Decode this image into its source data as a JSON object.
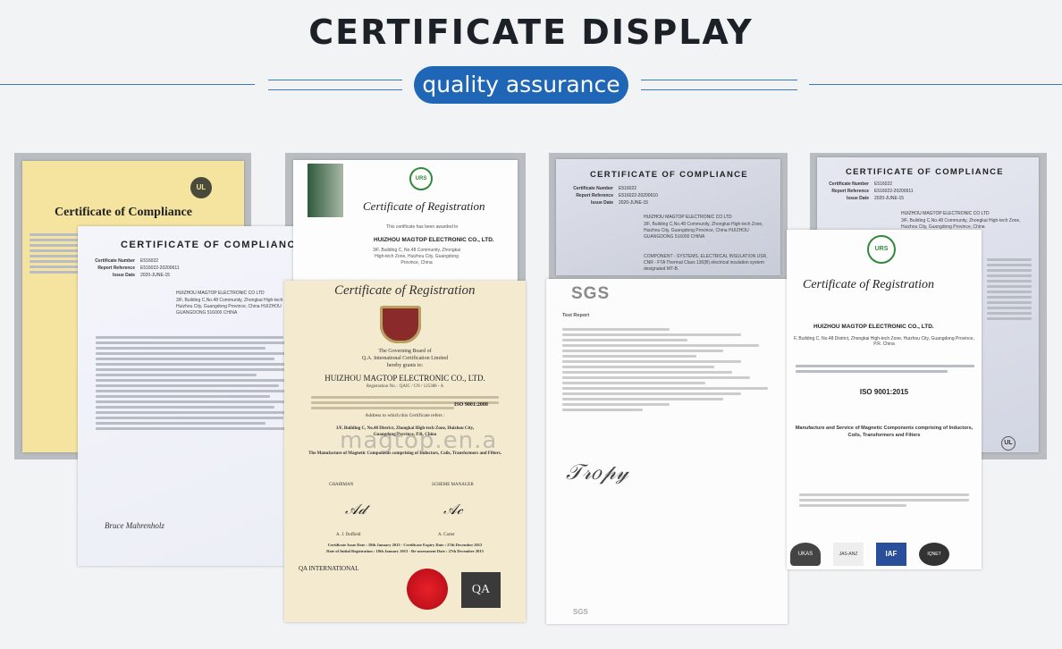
{
  "header": {
    "title": "CERTIFICATE DISPLAY",
    "subtitle": "quality assurance"
  },
  "watermark": "magtop.en.a",
  "certs": {
    "yellow": {
      "title": "Certificate of Compliance",
      "brand": "ul-mark",
      "color": "#f5e7a6"
    },
    "ul1": {
      "heading": "CERTIFICATE OF COMPLIANCE",
      "fields": [
        {
          "k": "Certificate Number",
          "v": "E516022"
        },
        {
          "k": "Report Reference",
          "v": "E516022-20200611"
        },
        {
          "k": "Issue Date",
          "v": "2020-JUNE-15"
        }
      ],
      "issued_to": "HUIZHOU MAGTOP ELECTRONIC CO LTD",
      "address": "3/F, Building C,No.48 Community, Zhongkai High-tech Zone, Huizhou City, Guangdong Province, China HUIZHOU GUANGDONG 516000 CHINA",
      "signature": "Bruce Mahrenholz"
    },
    "ul2": {
      "heading": "CERTIFICATE OF COMPLIANCE",
      "fields": [
        {
          "k": "Certificate Number",
          "v": "E516022"
        },
        {
          "k": "Report Reference",
          "v": "E516022-20200610"
        },
        {
          "k": "Issue Date",
          "v": "2020-JUNE-15"
        }
      ],
      "issued_to": "HUIZHOU MAGTOP ELECTRONIC CO LTD",
      "address": "3/F, Building C,No.48 Community, Zhongkai High-tech Zone, Huizhou City, Guangdong Province, China HUIZHOU GUANGDONG 516000 CHINA",
      "representative": "COMPONENT - SYSTEMS, ELECTRICAL INSULATION USR, CNR - FTA Thermal Class 130(B) electrical insulation system designated MT-B."
    },
    "ul3": {
      "heading": "CERTIFICATE OF COMPLIANCE",
      "fields": [
        {
          "k": "Certificate Number",
          "v": "E516022"
        },
        {
          "k": "Report Reference",
          "v": "E516022-20200611"
        },
        {
          "k": "Issue Date",
          "v": "2020-JUNE-15"
        }
      ],
      "issued_to": "HUIZHOU MAGTOP ELECTRONIC CO LTD",
      "address": "3/F, Building C,No.48 Community, Zhongkai High-tech Zone, Huizhou City, Guangdong Province, China"
    },
    "reg1": {
      "title": "Certificate of Registration",
      "awarded": "This certificate has been awarded to",
      "company": "HUIZHOU MAGTOP ELECTRONIC CO., LTD.",
      "address": "3/F, Building C, No.48 Community, Zhongkai High-tech Zone, Huizhou City, Guangdong Province, China"
    },
    "qa": {
      "title": "Certificate of Registration",
      "board": "The Governing Board of",
      "org": "Q.A. International Certification Limited",
      "grants": "hereby grants to:",
      "company": "HUIZHOU MAGTOP ELECTRONIC CO., LTD.",
      "reg_no": "Registration No. : QAIC / CN / 125388 - A",
      "standard": "ISO 9001:2008",
      "address_label": "Address to which this Certificate refers :",
      "address": "3/F, Building C, No.48 District, Zhongkai High-tech Zone, Huizhou City, Guangdong Province, P.R. China",
      "scope": "The Manufacture of Magnetic Components comprising of Inductors, Coils, Transformers and Filters.",
      "chairman": "CHAIRMAN",
      "scheme": "SCHEME MANAGER",
      "sig1": "A. J. Duffield",
      "sig2": "A. Carter",
      "issue": "Certificate Issue Date : 18th January 2013 - Certificate Expiry Date : 27th December 2013",
      "initial": "Date of Initial Registration : 18th January 2013 - Re-assessment Date : 27th December 2013",
      "footer_org": "QA INTERNATIONAL"
    },
    "sgs": {
      "logo": "SGS",
      "heading": "Test Report",
      "footer_logo": "SGS"
    },
    "reg2": {
      "title": "Certificate of Registration",
      "company": "HUIZHOU MAGTOP ELECTRONIC CO., LTD.",
      "address": "F, Building C, No.48 District, Zhongkai High-tech Zone, Huizhou City, Guangdong Province, P.R. China",
      "standard": "ISO 9001:2015",
      "scope": "Manufacture and Service of Magnetic Components comprising of Inductors, Coils, Transformers and Filters",
      "logos": [
        "UKAS",
        "JAS-ANZ",
        "IAF",
        "IQNET"
      ]
    }
  }
}
